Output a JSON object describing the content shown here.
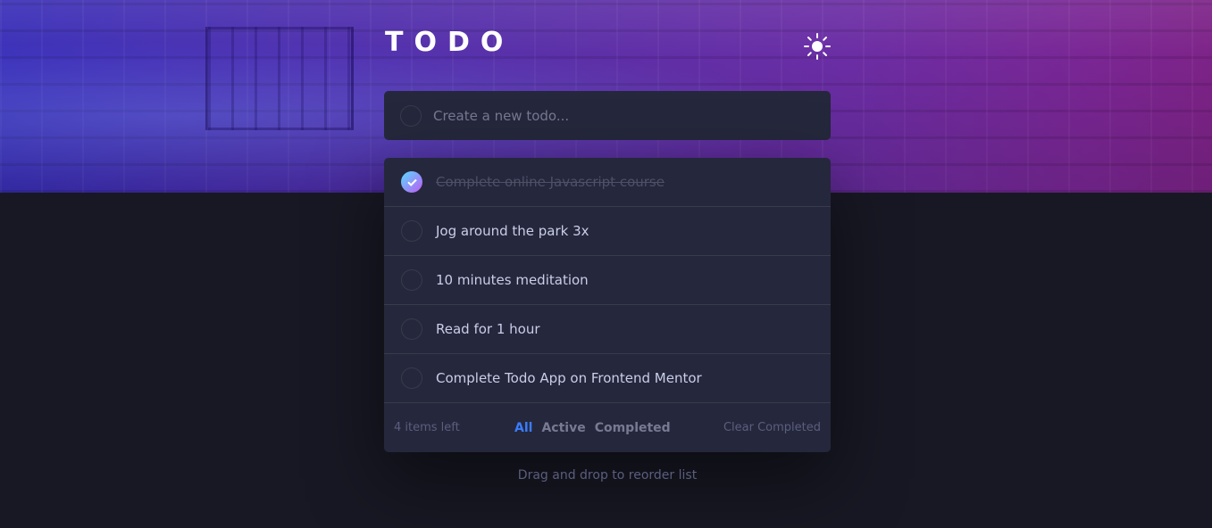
{
  "app": {
    "title": "TODO"
  },
  "theme_toggle": {
    "icon": "sun-icon"
  },
  "new_todo": {
    "placeholder": "Create a new todo..."
  },
  "todos": [
    {
      "text": "Complete online Javascript course",
      "completed": true
    },
    {
      "text": "Jog around the park 3x",
      "completed": false
    },
    {
      "text": "10 minutes meditation",
      "completed": false
    },
    {
      "text": "Read for 1 hour",
      "completed": false
    },
    {
      "text": "Complete Todo App on Frontend Mentor",
      "completed": false
    }
  ],
  "footer": {
    "items_left": "4 items left",
    "filters": [
      "All",
      "Active",
      "Completed"
    ],
    "active_filter": "All",
    "clear": "Clear Completed"
  },
  "hint": "Drag and drop to reorder list",
  "colors": {
    "background": "#181824",
    "card": "#25273c",
    "accent": "#3a7cfd",
    "check_gradient_start": "#55ddff",
    "check_gradient_end": "#c058f3"
  }
}
